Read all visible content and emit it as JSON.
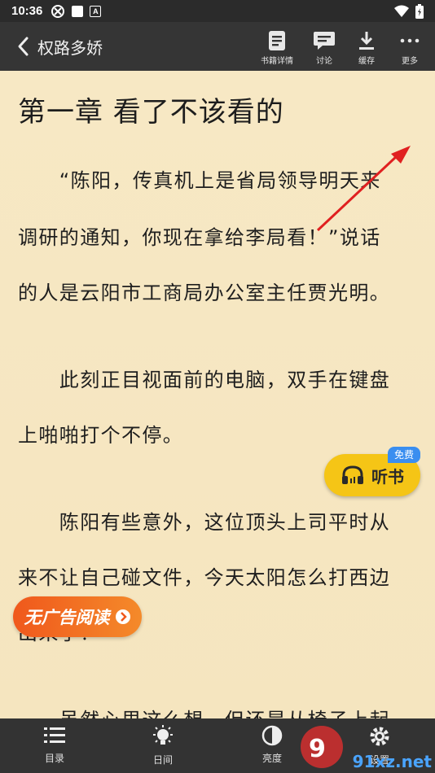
{
  "status_bar": {
    "time": "10:36"
  },
  "toolbar": {
    "title": "权路多娇",
    "buttons": [
      {
        "label": "书籍详情",
        "icon": "book-details-icon"
      },
      {
        "label": "讨论",
        "icon": "chat-icon"
      },
      {
        "label": "缓存",
        "icon": "download-icon"
      },
      {
        "label": "更多",
        "icon": "more-icon"
      }
    ]
  },
  "reader": {
    "chapter_title": "第一章 看了不该看的",
    "lines": [
      "　　“陈阳，传真机上是省局领导明天来",
      "调研的通知，你现在拿给李局看！”说话",
      "的人是云阳市工商局办公室主任贾光明。",
      "　　此刻正目视面前的电脑，双手在键盘",
      "上啪啪打个不停。",
      "　　陈阳有些意外，这位顶头上司平时从",
      "来不让自己碰文件，今天太阳怎么打西边",
      "出来了？",
      "　　虽然心里这么想，但还是从椅子上起"
    ]
  },
  "listen_button": {
    "label": "听书",
    "badge": "免费"
  },
  "no_ad_button": {
    "label": "无广告阅读"
  },
  "bottom_nav": [
    {
      "label": "目录",
      "icon": "list-icon"
    },
    {
      "label": "日间",
      "icon": "day-mode-icon"
    },
    {
      "label": "亮度",
      "icon": "brightness-icon"
    },
    {
      "label": "设置",
      "icon": "settings-icon"
    }
  ],
  "watermark": {
    "text": "91xz.net"
  },
  "colors": {
    "page_bg": "#f6e7c1",
    "toolbar_bg": "#353535",
    "listen_yellow": "#f5c516",
    "noad_orange": "#f0581c",
    "arrow_red": "#e02020"
  }
}
